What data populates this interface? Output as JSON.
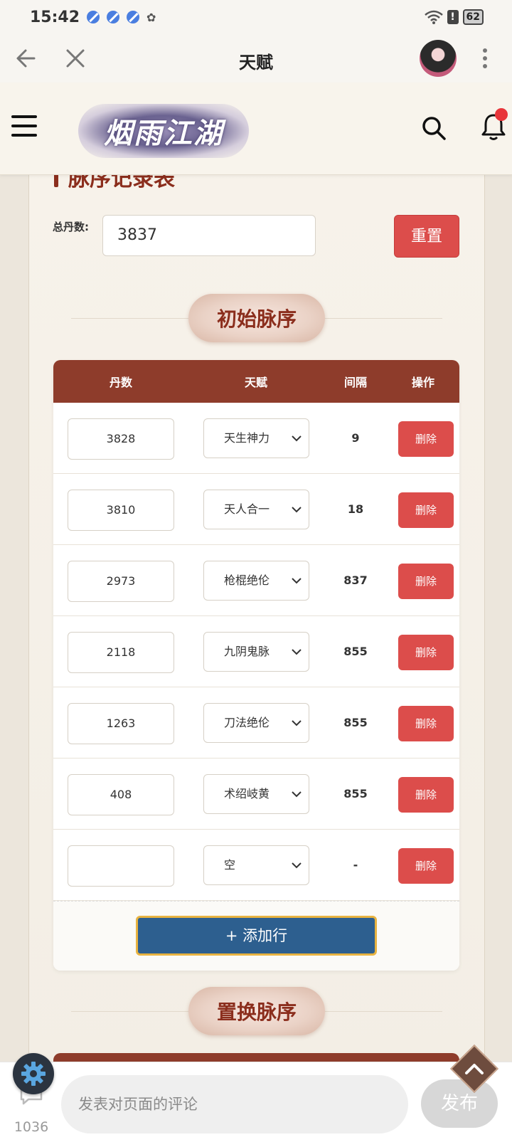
{
  "status": {
    "time": "15:42",
    "battery": "62",
    "alert": "!",
    "wechat": "✿"
  },
  "titlebar": {
    "title": "天赋"
  },
  "site": {
    "logo_text": "烟雨江湖"
  },
  "section": {
    "heading": "脉序记录表"
  },
  "total": {
    "label": "总丹数:",
    "value": "3837",
    "reset_label": "重置"
  },
  "initial": {
    "title": "初始脉序"
  },
  "table": {
    "headers": [
      "丹数",
      "天赋",
      "间隔",
      "操作"
    ],
    "rows": [
      {
        "dan": "3828",
        "talent": "天生神力",
        "gap": "9",
        "action": "删除"
      },
      {
        "dan": "3810",
        "talent": "天人合一",
        "gap": "18",
        "action": "删除"
      },
      {
        "dan": "2973",
        "talent": "枪棍绝伦",
        "gap": "837",
        "action": "删除"
      },
      {
        "dan": "2118",
        "talent": "九阴鬼脉",
        "gap": "855",
        "action": "删除"
      },
      {
        "dan": "1263",
        "talent": "刀法绝伦",
        "gap": "855",
        "action": "删除"
      },
      {
        "dan": "408",
        "talent": "术绍岐黄",
        "gap": "855",
        "action": "删除"
      },
      {
        "dan": "",
        "talent": "空",
        "gap": "-",
        "action": "删除"
      }
    ],
    "add_label": "+ 添加行"
  },
  "replace": {
    "title": "置换脉序"
  },
  "comment": {
    "count": "1036",
    "placeholder": "发表对页面的评论",
    "publish": "发布"
  }
}
